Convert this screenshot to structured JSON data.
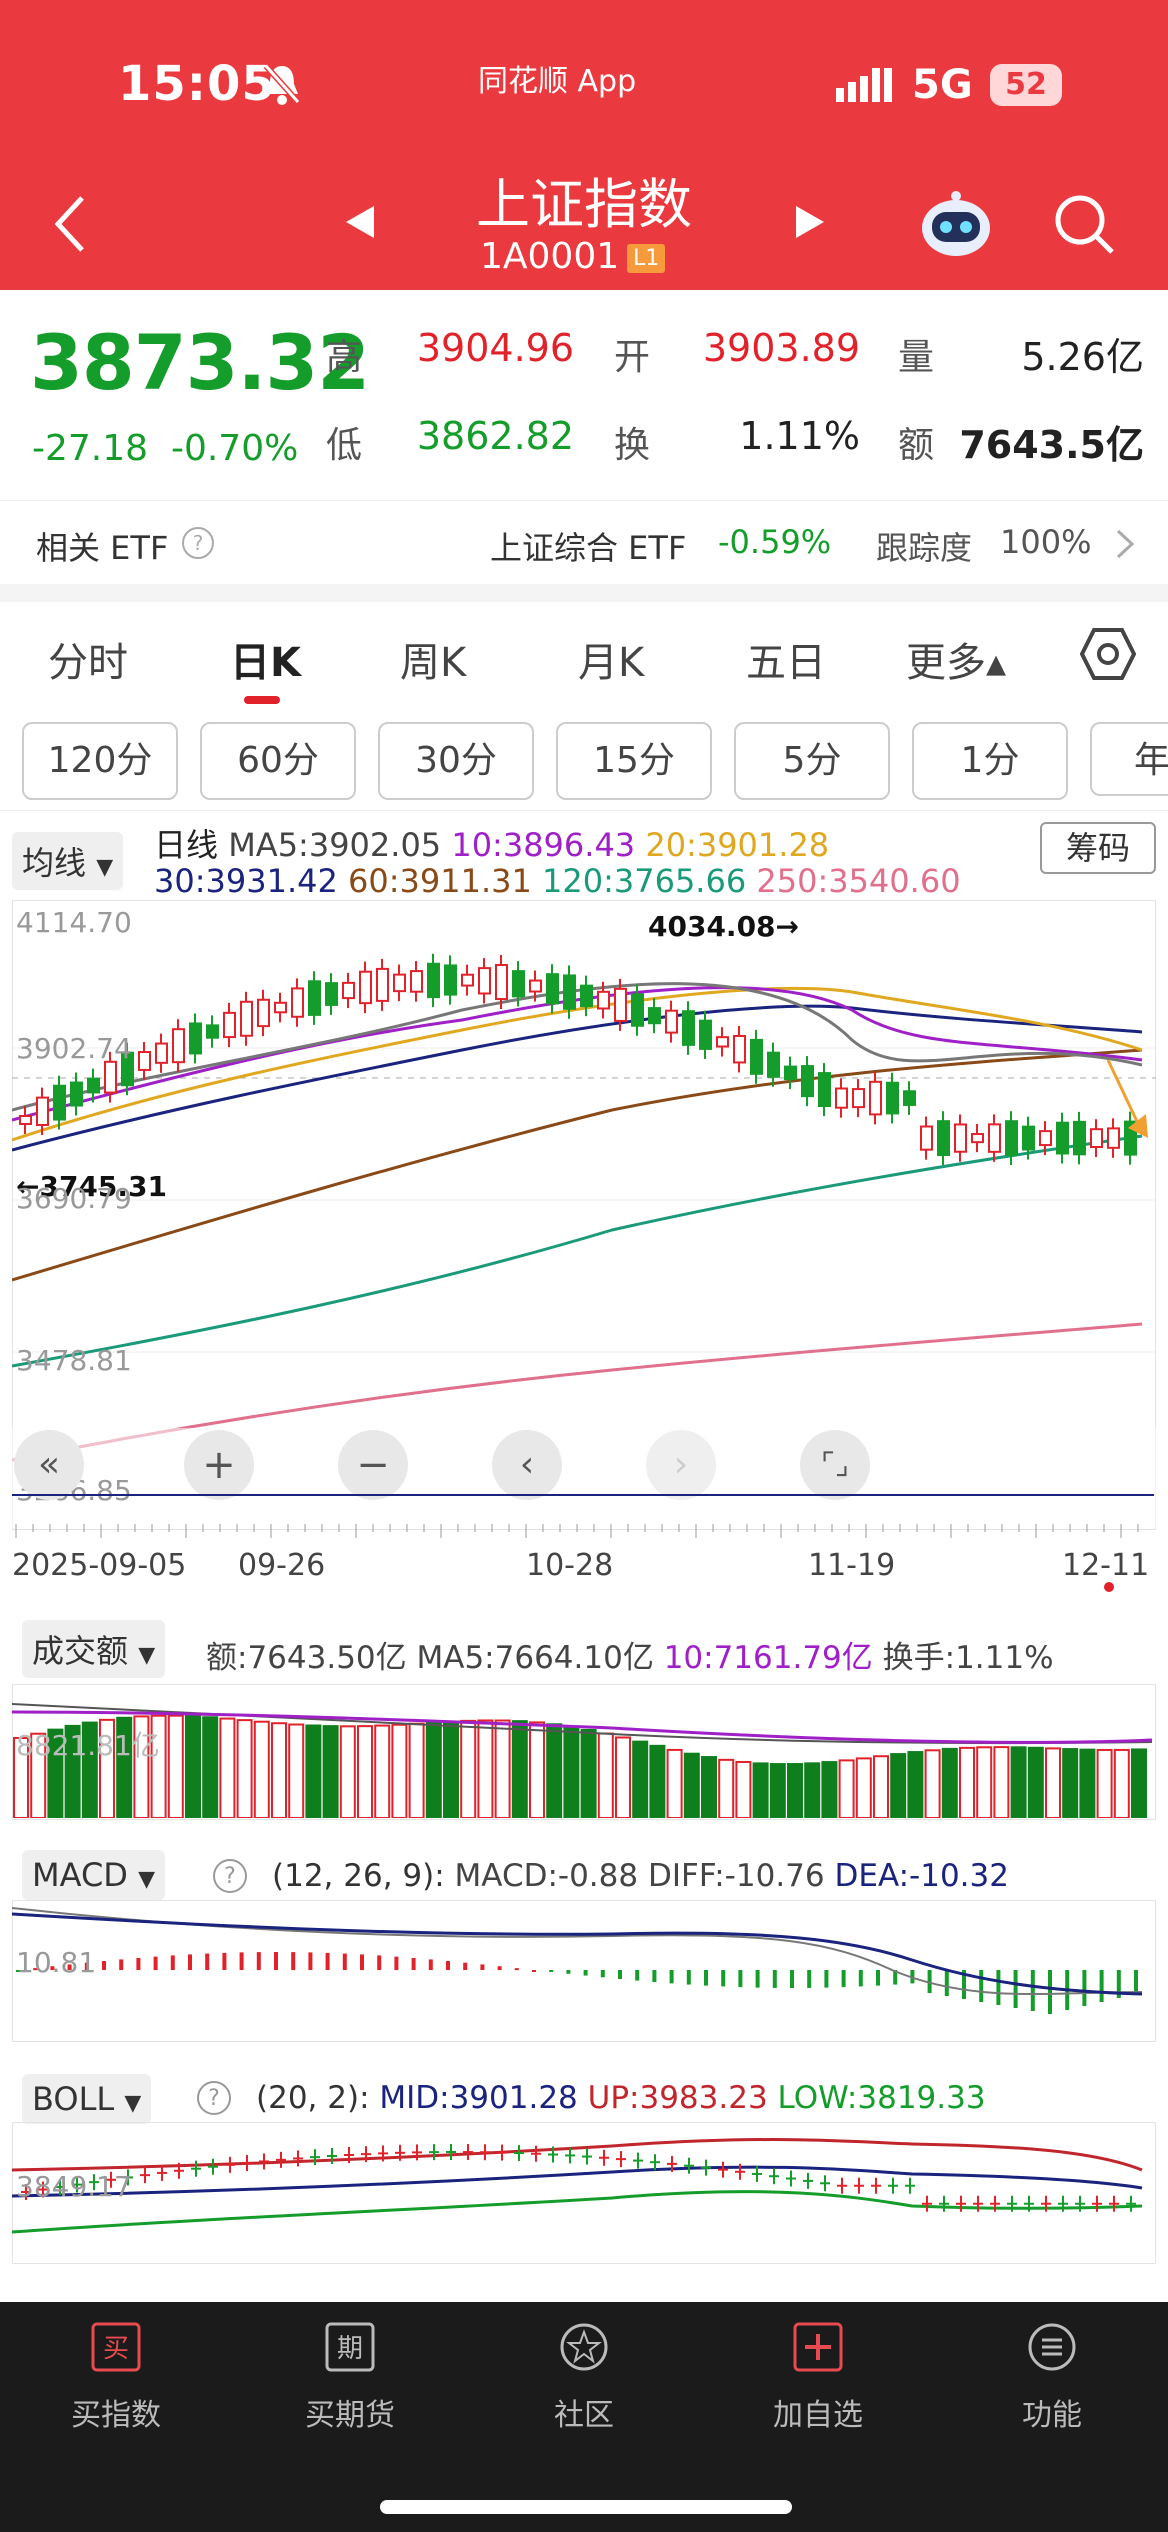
{
  "status": {
    "time": "15:05",
    "app": "同花顺 App",
    "network": "5G",
    "battery": "52"
  },
  "header": {
    "title": "上证指数",
    "code": "1A0001",
    "badge": "L1"
  },
  "quote": {
    "price": "3873.32",
    "change": "-27.18",
    "change_pct": "-0.70%",
    "high_label": "高",
    "high": "3904.96",
    "low_label": "低",
    "low": "3862.82",
    "open_label": "开",
    "open": "3903.89",
    "turnover_label": "换",
    "turnover": "1.11%",
    "volume_label": "量",
    "volume": "5.26亿",
    "amount_label": "额",
    "amount": "7643.5亿"
  },
  "etf": {
    "label": "相关 ETF",
    "name": "上证综合 ETF",
    "change": "-0.59%",
    "track_label": "跟踪度",
    "track": "100%"
  },
  "tabs": [
    "分时",
    "日K",
    "周K",
    "月K",
    "五日",
    "更多▴"
  ],
  "periods": [
    "120分",
    "60分",
    "30分",
    "15分",
    "5分",
    "1分",
    "年"
  ],
  "kline": {
    "indicator": "均线",
    "line_label": "日线",
    "ma5": "MA5:3902.05",
    "ma10": "10:3896.43",
    "ma20": "20:3901.28",
    "ma30": "30:3931.42",
    "ma60": "60:3911.31",
    "ma120": "120:3765.66",
    "ma250": "250:3540.60",
    "chip_button": "筹码",
    "y_top": "4114.70",
    "y_mid": "3902.74",
    "y_3": "3690.79",
    "y_4": "3478.81",
    "y_bot": "3266.85",
    "max_label": "4034.08→",
    "min_label": "←3745.31",
    "dates": [
      "2025-09-05",
      "09-26",
      "10-28",
      "11-19",
      "12-11"
    ]
  },
  "volume_panel": {
    "indicator": "成交额",
    "amount": "额:7643.50亿",
    "ma5": "MA5:7664.10亿",
    "ma10": "10:7161.79亿",
    "turnover": "换手:1.11%",
    "ylabel": "8821.81亿"
  },
  "macd_panel": {
    "indicator": "MACD",
    "params": "(12, 26, 9):",
    "macd": "MACD:-0.88",
    "diff": "DIFF:-10.76",
    "dea": "DEA:-10.32",
    "ylabel": "10.81"
  },
  "boll_panel": {
    "indicator": "BOLL",
    "params": "(20, 2):",
    "mid": "MID:3901.28",
    "up": "UP:3983.23",
    "low": "LOW:3819.33",
    "ylabel": "3849.17"
  },
  "bottom_nav": [
    "买指数",
    "买期货",
    "社区",
    "加自选",
    "功能"
  ],
  "colors": {
    "up": "#e1222a",
    "down": "#159d2b",
    "header": "#eb3a3f"
  }
}
